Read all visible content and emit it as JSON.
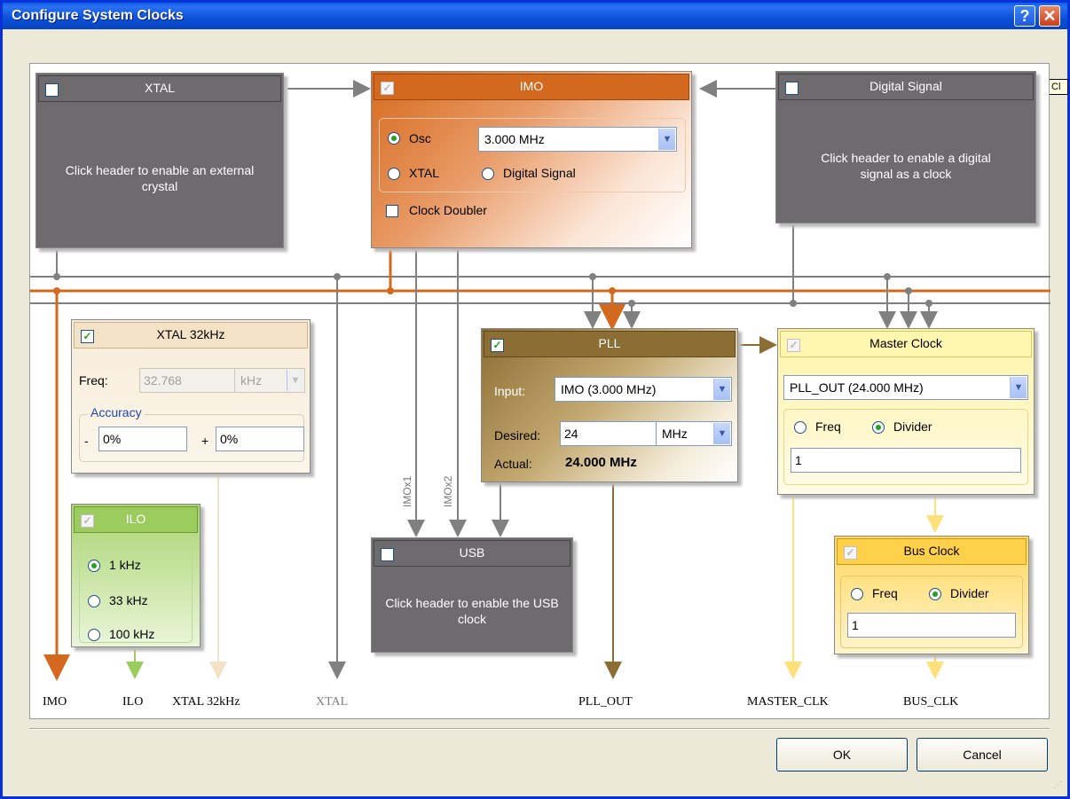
{
  "window": {
    "title": "Configure System Clocks",
    "help_glyph": "?",
    "close_glyph": "✕",
    "tooltip_fragment": "Cl"
  },
  "colors": {
    "imo": "#d2691e",
    "pll": "#8c6d33",
    "gray_wire": "#808080",
    "xtal32": "#f3e2c5",
    "ilo": "#9ccc5e",
    "master": "#fff6b0",
    "bus": "#ffd04a"
  },
  "xtal": {
    "title": "XTAL",
    "message": "Click header to enable an external crystal"
  },
  "imo": {
    "title": "IMO",
    "osc_label": "Osc",
    "freq_value": "3.000 MHz",
    "xtal_label": "XTAL",
    "digital_label": "Digital Signal",
    "doubler_label": "Clock Doubler"
  },
  "digital_signal": {
    "title": "Digital Signal",
    "message": "Click header to enable a digital signal as a clock"
  },
  "xtal32": {
    "title": "XTAL 32kHz",
    "freq_label": "Freq:",
    "freq_value": "32.768",
    "freq_unit": "kHz",
    "accuracy_label": "Accuracy",
    "minus": "-",
    "plus": "+",
    "minus_value": "0%",
    "plus_value": "0%"
  },
  "ilo": {
    "title": "ILO",
    "options": [
      "1 kHz",
      "33 kHz",
      "100 kHz"
    ]
  },
  "pll": {
    "title": "PLL",
    "input_label": "Input:",
    "input_value": "IMO (3.000 MHz)",
    "desired_label": "Desired:",
    "desired_value": "24",
    "desired_unit": "MHz",
    "actual_label": "Actual:",
    "actual_value": "24.000 MHz"
  },
  "master_clock": {
    "title": "Master Clock",
    "source_value": "PLL_OUT (24.000 MHz)",
    "freq_label": "Freq",
    "divider_label": "Divider",
    "divider_value": "1"
  },
  "usb": {
    "title": "USB",
    "message": "Click header to enable the USB clock",
    "imo_x1": "IMOx1",
    "imo_x2": "IMOx2"
  },
  "bus_clock": {
    "title": "Bus Clock",
    "freq_label": "Freq",
    "divider_label": "Divider",
    "divider_value": "1"
  },
  "outputs": {
    "imo": "IMO",
    "ilo": "ILO",
    "xtal32": "XTAL 32kHz",
    "xtal": "XTAL",
    "pll_out": "PLL_OUT",
    "master_clk": "MASTER_CLK",
    "bus_clk": "BUS_CLK"
  },
  "buttons": {
    "ok": "OK",
    "cancel": "Cancel"
  }
}
